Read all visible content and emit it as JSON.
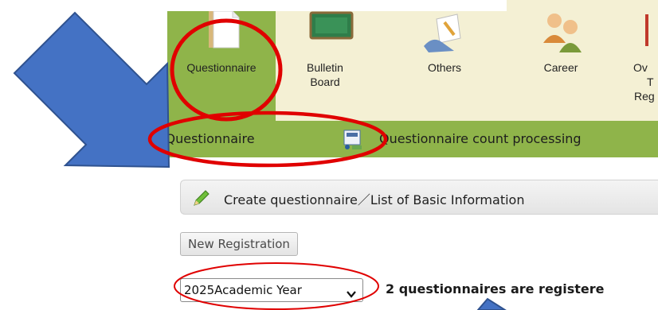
{
  "nav": {
    "items": [
      {
        "label": "Questionnaire",
        "icon": "document-icon",
        "active": true
      },
      {
        "label_line1": "Bulletin",
        "label_line2": "Board",
        "icon": "chalkboard-icon"
      },
      {
        "label": "Others",
        "icon": "pencil-note-icon"
      },
      {
        "label": "Career",
        "icon": "people-icon"
      },
      {
        "label_line1": "Ov",
        "label_line2": "T",
        "label_line3": "Reg",
        "icon": "book-icon"
      }
    ]
  },
  "submenu": {
    "items": [
      {
        "label": "er Questionnaire"
      },
      {
        "label": "Questionnaire count processing",
        "icon": "calculator-icon"
      }
    ]
  },
  "section": {
    "title": "Create questionnaire／List of Basic Information",
    "icon": "pencil-icon"
  },
  "toolbar": {
    "new_registration_label": "New Registration"
  },
  "filter": {
    "year_selected": "2025Academic Year",
    "registered_text": "2 questionnaires are registere"
  },
  "colors": {
    "nav_active_bg": "#8fb44a",
    "nav_bg": "#f4f0d4",
    "submenu_bg": "#8fb44a",
    "annotation_red": "#e00000",
    "annotation_arrow": "#4472c4"
  }
}
